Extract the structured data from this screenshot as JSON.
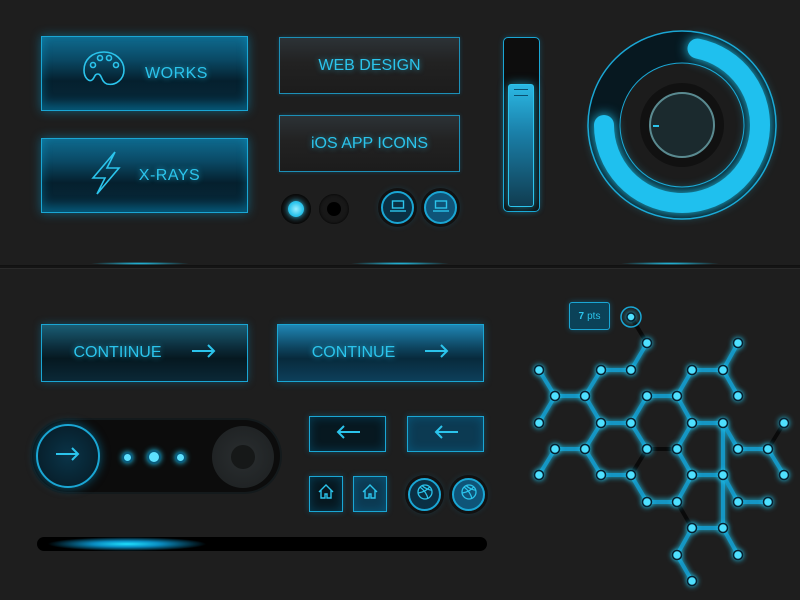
{
  "buttons": {
    "works": "WORKS",
    "xrays": "X-RAYS",
    "web_design": "WEB DESIGN",
    "ios_app_icons": "iOS APP ICONS",
    "continue_1": "CONTIINUE",
    "continue_2": "CONTINUE"
  },
  "slider": {
    "level_percent": 75
  },
  "gauge": {
    "level_percent": 75
  },
  "progress": {
    "level_percent": 20
  },
  "pager": {
    "dots": 3,
    "active": 2
  },
  "tooltip": {
    "value": "7",
    "unit": "pts"
  },
  "colors": {
    "accent": "#22c8f0",
    "border": "#1aa6d4",
    "background": "#1e1e1e"
  }
}
